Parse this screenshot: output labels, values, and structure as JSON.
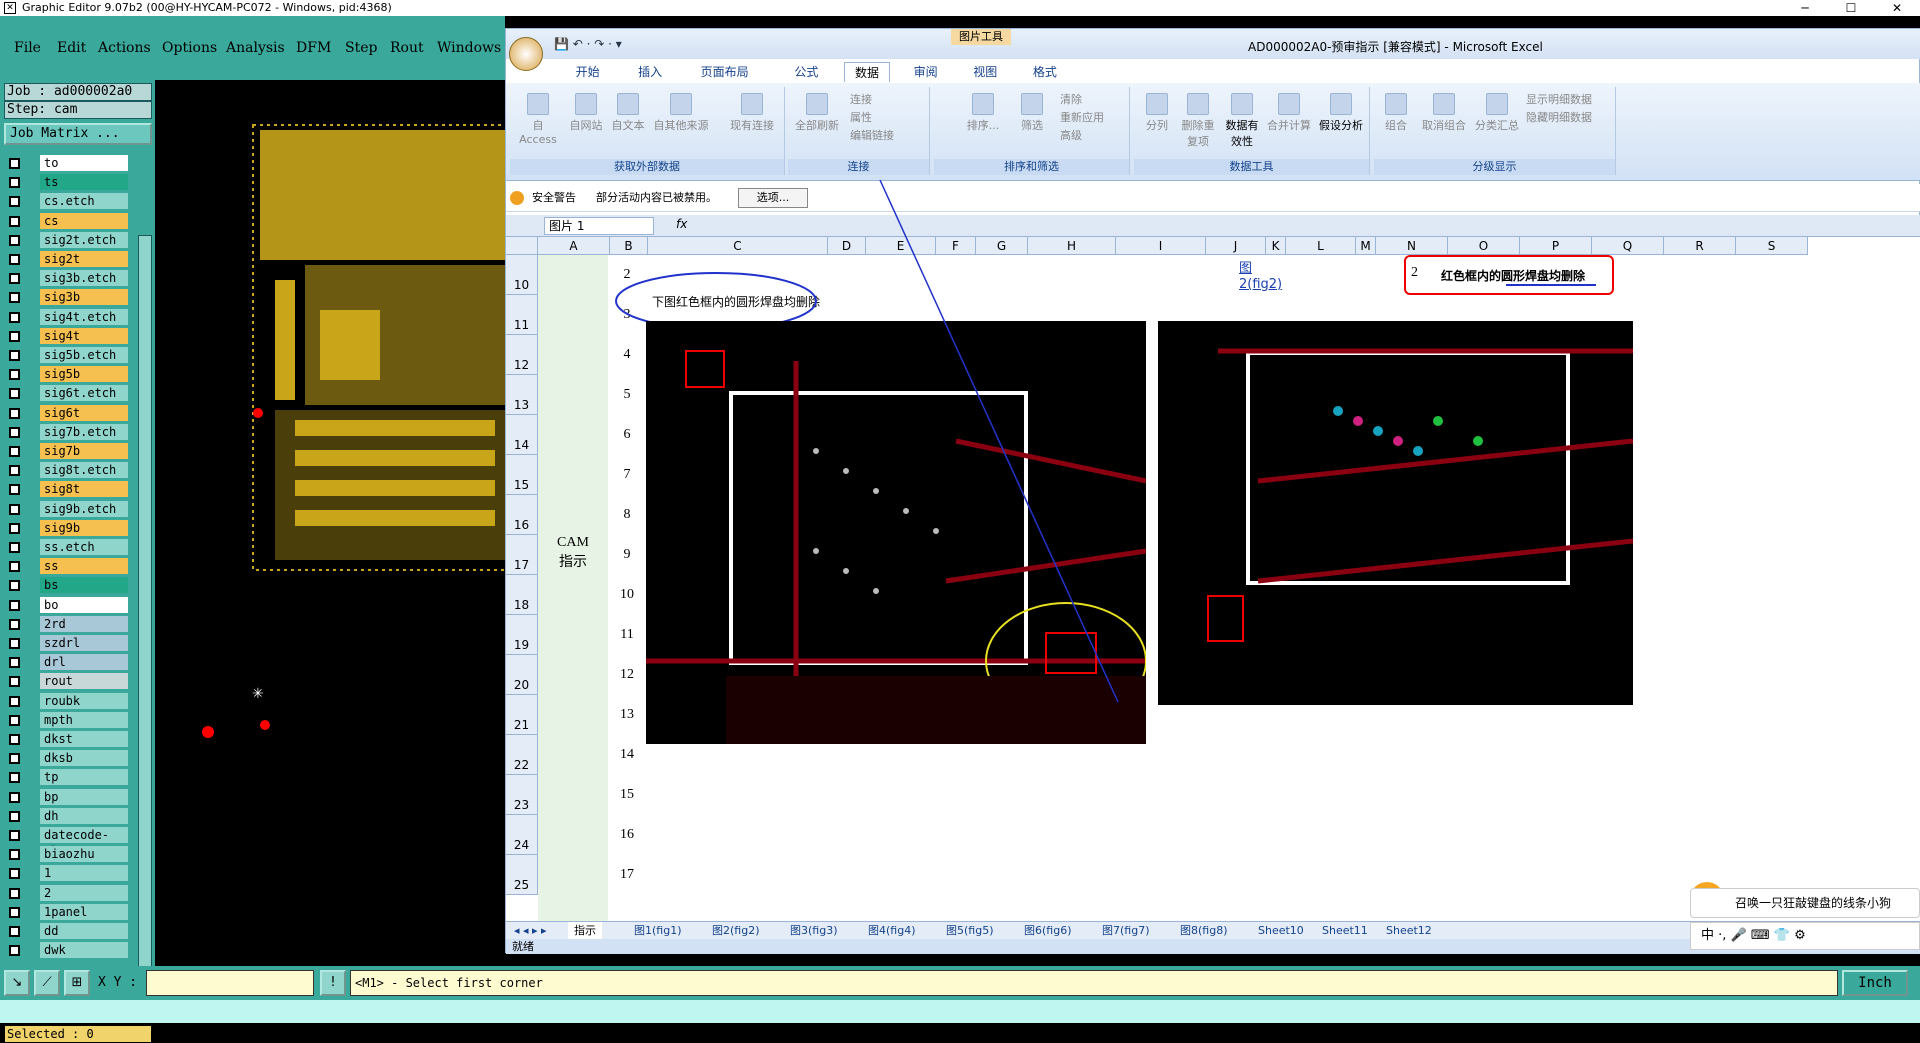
{
  "graphic_editor": {
    "title": "Graphic Editor 9.07b2 (00@HY-HYCAM-PC072 - Windows, pid:4368)",
    "menu": [
      "File",
      "Edit",
      "Actions",
      "Options",
      "Analysis",
      "DFM",
      "Step",
      "Rout",
      "Windows"
    ],
    "job_line": "Job : ad000002a0",
    "step_line": "Step: cam",
    "job_matrix_label": "Job Matrix ...",
    "layers": [
      {
        "name": "to",
        "color": "#ffffff"
      },
      {
        "name": "ts",
        "color": "#22a888"
      },
      {
        "name": "cs.etch",
        "color": "#8fd5cc"
      },
      {
        "name": "cs",
        "color": "#f5c050"
      },
      {
        "name": "sig2t.etch",
        "color": "#8fd5cc"
      },
      {
        "name": "sig2t",
        "color": "#f5c050"
      },
      {
        "name": "sig3b.etch",
        "color": "#8fd5cc"
      },
      {
        "name": "sig3b",
        "color": "#f5c050"
      },
      {
        "name": "sig4t.etch",
        "color": "#8fd5cc"
      },
      {
        "name": "sig4t",
        "color": "#f5c050"
      },
      {
        "name": "sig5b.etch",
        "color": "#8fd5cc"
      },
      {
        "name": "sig5b",
        "color": "#f5c050"
      },
      {
        "name": "sig6t.etch",
        "color": "#8fd5cc"
      },
      {
        "name": "sig6t",
        "color": "#f5c050"
      },
      {
        "name": "sig7b.etch",
        "color": "#8fd5cc"
      },
      {
        "name": "sig7b",
        "color": "#f5c050"
      },
      {
        "name": "sig8t.etch",
        "color": "#8fd5cc"
      },
      {
        "name": "sig8t",
        "color": "#f5c050"
      },
      {
        "name": "sig9b.etch",
        "color": "#8fd5cc"
      },
      {
        "name": "sig9b",
        "color": "#f5c050"
      },
      {
        "name": "ss.etch",
        "color": "#8fd5cc"
      },
      {
        "name": "ss",
        "color": "#f5c050"
      },
      {
        "name": "bs",
        "color": "#22a888"
      },
      {
        "name": "bo",
        "color": "#ffffff"
      },
      {
        "name": "2rd",
        "color": "#a8c8d8"
      },
      {
        "name": "szdrl",
        "color": "#a8c8d8"
      },
      {
        "name": "drl",
        "color": "#a8c8d8"
      },
      {
        "name": "rout",
        "color": "#c8d8d8"
      },
      {
        "name": "roubk",
        "color": "#8fd5cc"
      },
      {
        "name": "mpth",
        "color": "#8fd5cc"
      },
      {
        "name": "dkst",
        "color": "#8fd5cc"
      },
      {
        "name": "dksb",
        "color": "#8fd5cc"
      },
      {
        "name": "tp",
        "color": "#8fd5cc"
      },
      {
        "name": "bp",
        "color": "#8fd5cc"
      },
      {
        "name": "dh",
        "color": "#8fd5cc"
      },
      {
        "name": "datecode-pbe",
        "color": "#8fd5cc"
      },
      {
        "name": "biaozhu",
        "color": "#8fd5cc"
      },
      {
        "name": "1",
        "color": "#8fd5cc"
      },
      {
        "name": "2",
        "color": "#8fd5cc"
      },
      {
        "name": "1panel",
        "color": "#8fd5cc"
      },
      {
        "name": "dd",
        "color": "#8fd5cc"
      },
      {
        "name": "dwk",
        "color": "#8fd5cc"
      }
    ],
    "selected": "Selected : 0",
    "xy_label": "X Y :",
    "prompt": "<M1> - Select first corner",
    "unit": "Inch"
  },
  "excel": {
    "title": "AD000002A0-预审指示 [兼容模式] - Microsoft Excel",
    "picture_tools": "图片工具",
    "tabs": [
      "开始",
      "插入",
      "页面布局",
      "公式",
      "数据",
      "审阅",
      "视图",
      "格式"
    ],
    "active_tab": "数据",
    "groups": [
      {
        "label": "获取外部数据",
        "buttons": [
          "自 Access",
          "自网站",
          "自文本",
          "自其他来源",
          "现有连接"
        ]
      },
      {
        "label": "连接",
        "buttons": [
          "全部刷新"
        ],
        "small": [
          "连接",
          "属性",
          "编辑链接"
        ]
      },
      {
        "label": "排序和筛选",
        "buttons": [
          "排序...",
          "筛选"
        ],
        "small": [
          "清除",
          "重新应用",
          "高级"
        ]
      },
      {
        "label": "数据工具",
        "buttons": [
          "分列",
          "删除重复项",
          "数据有效性",
          "合并计算",
          "假设分析"
        ]
      },
      {
        "label": "分级显示",
        "buttons": [
          "组合",
          "取消组合",
          "分类汇总"
        ],
        "small": [
          "显示明细数据",
          "隐藏明细数据"
        ]
      }
    ],
    "security_warning": "安全警告",
    "security_text": "部分活动内容已被禁用。",
    "options_btn": "选项...",
    "name_box": "图片 1",
    "fx": "fx",
    "columns": [
      "A",
      "B",
      "C",
      "D",
      "E",
      "F",
      "G",
      "H",
      "I",
      "J",
      "K",
      "L",
      "M",
      "N",
      "O",
      "P",
      "Q",
      "R",
      "S"
    ],
    "rows": [
      "10",
      "11",
      "12",
      "13",
      "14",
      "15",
      "16",
      "17",
      "18",
      "19",
      "20",
      "21",
      "22",
      "23",
      "24",
      "25"
    ],
    "b_numbers": [
      "2",
      "3",
      "4",
      "5",
      "6",
      "7",
      "8",
      "9",
      "10",
      "11",
      "12",
      "13",
      "14",
      "15",
      "16",
      "17"
    ],
    "cam_label": "CAM指示",
    "note_left": "下图红色框内的圆形焊盘均删除",
    "note_right_num": "2",
    "note_right": "红色框内的圆形焊盘均删除",
    "j_link": "图2(fig2)",
    "sheet_tabs": [
      "指示",
      "图1(fig1)",
      "图2(fig2)",
      "图3(fig3)",
      "图4(fig4)",
      "图5(fig5)",
      "图6(fig6)",
      "图7(fig7)",
      "图8(fig8)",
      "Sheet10",
      "Sheet11",
      "Sheet12"
    ],
    "status": "就绪"
  },
  "ime": {
    "popup": "召唤一只狂敲键盘的线条小狗",
    "bar": "中 ·, 🎤 ⌨ 👕 ⚙"
  }
}
